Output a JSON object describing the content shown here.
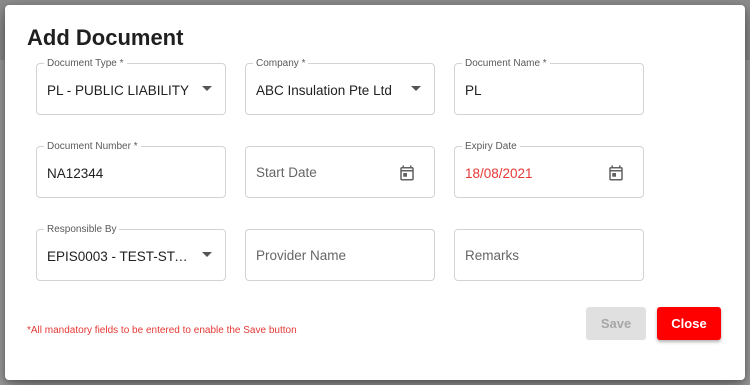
{
  "dialog": {
    "title": "Add Document",
    "fields": {
      "document_type": {
        "label": "Document Type *",
        "value": "PL - PUBLIC LIABILITY"
      },
      "company": {
        "label": "Company *",
        "value": "ABC Insulation Pte Ltd"
      },
      "document_name": {
        "label": "Document Name *",
        "value": "PL"
      },
      "document_number": {
        "label": "Document Number *",
        "value": "NA12344"
      },
      "start_date": {
        "placeholder": "Start Date"
      },
      "expiry_date": {
        "label": "Expiry Date",
        "value": "18/08/2021"
      },
      "responsible_by": {
        "label": "Responsible By",
        "value": "EPIS0003 - TEST-STAF..."
      },
      "provider_name": {
        "placeholder": "Provider Name"
      },
      "remarks": {
        "placeholder": "Remarks"
      }
    },
    "mandatory_note": "*All mandatory fields to be entered to enable the Save button",
    "buttons": {
      "save": "Save",
      "close": "Close"
    },
    "icons": {
      "dropdown": "chevron-down-icon",
      "calendar": "calendar-icon"
    },
    "colors": {
      "error": "#e53935",
      "close_button": "#ff0000",
      "disabled": "#e0e0e0"
    }
  }
}
